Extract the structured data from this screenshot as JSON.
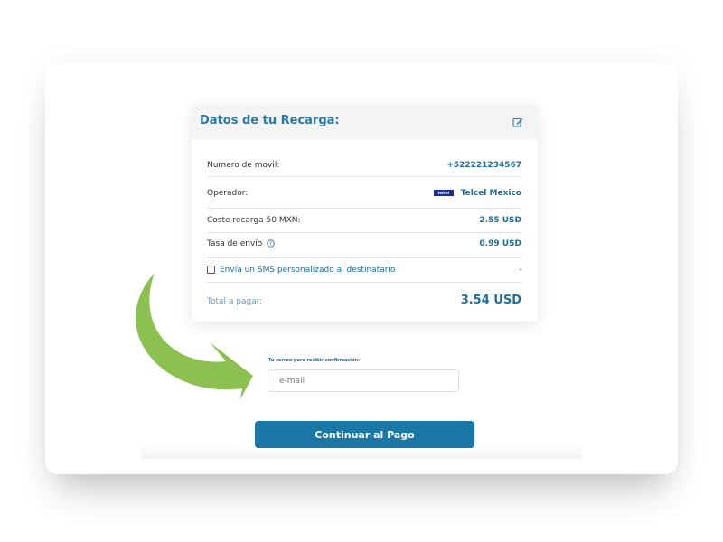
{
  "card": {
    "title": "Datos de tu Recarga:",
    "edit_icon": "edit-icon",
    "rows": [
      {
        "label": "Numero de movil:",
        "value": "+522221234567"
      },
      {
        "label": "Operador:",
        "value": "Telcel Mexico",
        "logo_text": "telcel"
      },
      {
        "label": "Coste recarga 50 MXN:",
        "value": "2.55 USD"
      },
      {
        "label": "Tasa de envío",
        "value": "0.99 USD",
        "icon": "help-icon"
      },
      {
        "label": "Envía un SMS personalizado al destinatario",
        "value": "-",
        "checked": false
      }
    ],
    "total_label": "Total a pagar:",
    "total_value": "3.54 USD"
  },
  "email": {
    "label": "Tu correo para recibir confirmación:",
    "placeholder": "e-mail",
    "value": ""
  },
  "continue_label": "Continuar al Pago",
  "colors": {
    "accent": "#1b77a5",
    "title": "#2a78a6",
    "arrow": "#8cc152"
  }
}
